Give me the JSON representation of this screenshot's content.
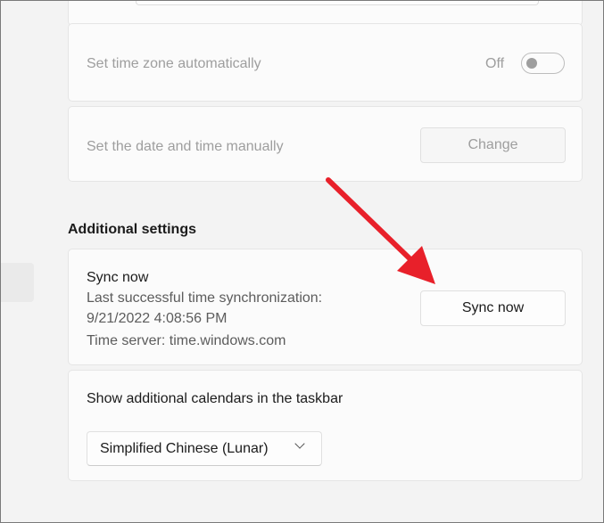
{
  "timezone": {
    "label": "Set time zone automatically",
    "state": "Off",
    "on": false
  },
  "manual": {
    "label": "Set the date and time manually",
    "button": "Change"
  },
  "section_title": "Additional settings",
  "sync": {
    "title": "Sync now",
    "line1": "Last successful time synchronization:",
    "line2": "9/21/2022 4:08:56 PM",
    "line3": "Time server: time.windows.com",
    "button": "Sync now"
  },
  "calendars": {
    "label": "Show additional calendars in the taskbar",
    "selected": "Simplified Chinese (Lunar)"
  },
  "colors": {
    "arrow": "#e8202a"
  }
}
